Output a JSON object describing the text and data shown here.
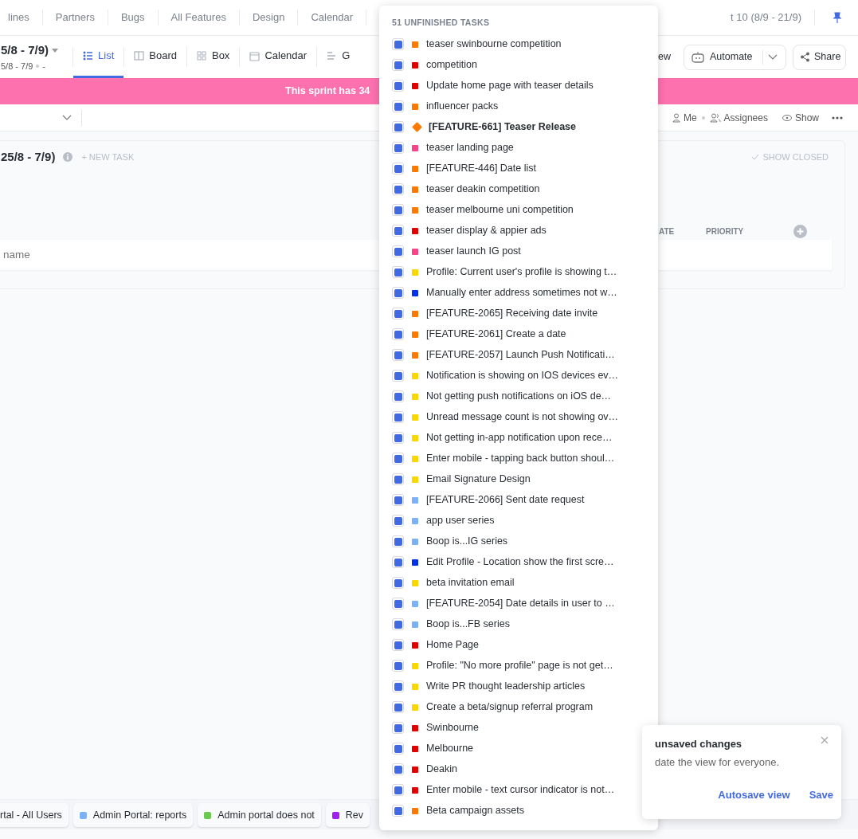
{
  "top_tabs": [
    {
      "label": "lines"
    },
    {
      "label": "Partners"
    },
    {
      "label": "Bugs"
    },
    {
      "label": "All Features"
    },
    {
      "label": "Design"
    },
    {
      "label": "Calendar"
    },
    {
      "label": "t 10 (8/9 - 21/9)"
    }
  ],
  "view_bar": {
    "title": "5/8 - 7/9)",
    "subtitle": "5/8 - 7/9",
    "subtitle_extra": "-",
    "views": [
      {
        "label": "List",
        "selected": true
      },
      {
        "label": "Board",
        "selected": false
      },
      {
        "label": "Box",
        "selected": false
      },
      {
        "label": "Calendar",
        "selected": false
      },
      {
        "label": "G",
        "selected": false
      }
    ],
    "view_button": "ew",
    "automate": "Automate",
    "share": "Share"
  },
  "banner": "This sprint has 34",
  "filter_bar": {
    "me": "Me",
    "assignees": "Assignees",
    "show": "Show"
  },
  "list_card": {
    "title": "25/8 - 7/9)",
    "new_task": "+ NEW TASK",
    "show_closed": "SHOW CLOSED",
    "columns": [
      "ATE",
      "PRIORITY"
    ],
    "new_row_placeholder": "name"
  },
  "tray": [
    {
      "label": "rtal - All Users"
    },
    {
      "label": "Admin Portal: reports",
      "color": "#7cb0f7"
    },
    {
      "label": "Admin portal does not",
      "color": "#6bc950"
    },
    {
      "label": "Rev",
      "color": "#a020f0"
    }
  ],
  "popup": {
    "title": "51 UNFINISHED TASKS",
    "tasks": [
      {
        "name": "teaser swinbourne competition",
        "color": "#ff7800",
        "kind": "task",
        "checked": true
      },
      {
        "name": "competition",
        "color": "#e50000",
        "kind": "task",
        "checked": true
      },
      {
        "name": "Update home page with teaser details",
        "color": "#e50000",
        "kind": "task",
        "checked": true
      },
      {
        "name": "influencer packs",
        "color": "#ff7800",
        "kind": "task",
        "checked": true
      },
      {
        "name": "[FEATURE-661] Teaser Release",
        "color": "#ff7800",
        "kind": "milestone",
        "checked": true
      },
      {
        "name": "teaser landing page",
        "color": "#f9448a",
        "kind": "task",
        "checked": true
      },
      {
        "name": "[FEATURE-446] Date list",
        "color": "#ff7800",
        "kind": "task",
        "checked": true
      },
      {
        "name": "teaser deakin competition",
        "color": "#ff7800",
        "kind": "task",
        "checked": true
      },
      {
        "name": "teaser melbourne uni competition",
        "color": "#ff7800",
        "kind": "task",
        "checked": true
      },
      {
        "name": "teaser display & appier ads",
        "color": "#e50000",
        "kind": "task",
        "checked": true
      },
      {
        "name": "teaser launch IG post",
        "color": "#f9448a",
        "kind": "task",
        "checked": true
      },
      {
        "name": "Profile: Current user's profile is showing t…",
        "color": "#f8d800",
        "kind": "task",
        "checked": true
      },
      {
        "name": "Manually enter address sometimes not w…",
        "color": "#0231e8",
        "kind": "task",
        "checked": true
      },
      {
        "name": "[FEATURE-2065] Receiving date invite",
        "color": "#ff7800",
        "kind": "task",
        "checked": true
      },
      {
        "name": "[FEATURE-2061] Create a date",
        "color": "#ff7800",
        "kind": "task",
        "checked": true
      },
      {
        "name": "[FEATURE-2057] Launch Push Notificati…",
        "color": "#ff7800",
        "kind": "task",
        "checked": true
      },
      {
        "name": "Notification is showing on IOS devices ev…",
        "color": "#f8d800",
        "kind": "task",
        "checked": true
      },
      {
        "name": "Not getting push notifications on iOS de…",
        "color": "#f8d800",
        "kind": "task",
        "checked": true
      },
      {
        "name": "Unread message count is not showing ov…",
        "color": "#f8d800",
        "kind": "task",
        "checked": true
      },
      {
        "name": "Not getting in-app notification upon rece…",
        "color": "#f8d800",
        "kind": "task",
        "checked": true
      },
      {
        "name": "Enter mobile - tapping back button shoul…",
        "color": "#f8d800",
        "kind": "task",
        "checked": true
      },
      {
        "name": "Email Signature Design",
        "color": "#f8d800",
        "kind": "task",
        "checked": true
      },
      {
        "name": "[FEATURE-2066] Sent date request",
        "color": "#7cb0f7",
        "kind": "task",
        "checked": true
      },
      {
        "name": "app user series",
        "color": "#7cb0f7",
        "kind": "task",
        "checked": true
      },
      {
        "name": "Boop is...IG series",
        "color": "#7cb0f7",
        "kind": "task",
        "checked": true
      },
      {
        "name": "Edit Profile - Location show the first scre…",
        "color": "#0231e8",
        "kind": "task",
        "checked": true
      },
      {
        "name": "beta invitation email",
        "color": "#f8d800",
        "kind": "task",
        "checked": true
      },
      {
        "name": "[FEATURE-2054] Date details in user to …",
        "color": "#7cb0f7",
        "kind": "task",
        "checked": true
      },
      {
        "name": "Boop is...FB series",
        "color": "#7cb0f7",
        "kind": "task",
        "checked": true
      },
      {
        "name": "Home Page",
        "color": "#e50000",
        "kind": "task",
        "checked": true
      },
      {
        "name": "Profile: \"No more profile\" page is not get…",
        "color": "#f8d800",
        "kind": "task",
        "checked": true
      },
      {
        "name": "Write PR thought leadership articles",
        "color": "#f8d800",
        "kind": "task",
        "checked": true
      },
      {
        "name": "Create a beta/signup referral program",
        "color": "#f8d800",
        "kind": "task",
        "checked": true
      },
      {
        "name": "Swinbourne",
        "color": "#e50000",
        "kind": "task",
        "checked": true
      },
      {
        "name": "Melbourne",
        "color": "#e50000",
        "kind": "task",
        "checked": true
      },
      {
        "name": "Deakin",
        "color": "#e50000",
        "kind": "task",
        "checked": true
      },
      {
        "name": "Enter mobile - text cursor indicator is not…",
        "color": "#e50000",
        "kind": "task",
        "checked": true
      },
      {
        "name": "Beta campaign assets",
        "color": "#ff7800",
        "kind": "task",
        "checked": true
      }
    ]
  },
  "toast": {
    "title": "unsaved changes",
    "message": "date the view for everyone.",
    "actions": [
      "Autosave view",
      "Save"
    ]
  }
}
